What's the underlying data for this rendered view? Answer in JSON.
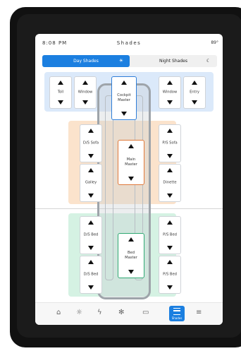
{
  "status": {
    "time": "8:08 PM",
    "title": "Shades",
    "temp": "89°"
  },
  "toggle": {
    "day_label": "Day Shades",
    "day_icon": "sun-icon",
    "night_label": "Night Shades",
    "night_icon": "moon-icon"
  },
  "controls": {
    "toll": "Toll",
    "window_left": "Window",
    "cockpit_master": "Cockpit\nMaster",
    "window_right": "Window",
    "entry": "Entry",
    "ds_sofa": "D/S Sofa",
    "ps_sofa": "P/S Sofa",
    "main_master": "Main\nMaster",
    "galley": "Galley",
    "dinette": "Dinette",
    "ds_bed_top": "D/S Bed",
    "ps_bed_top": "P/S Bed",
    "bed_master": "Bed\nMaster",
    "ds_bed_bottom": "D/S Bed",
    "ps_bed_bottom": "P/S Bed"
  },
  "nav": {
    "items": [
      "home-icon",
      "sun-icon",
      "lightning-icon",
      "fan-icon",
      "slideout-icon",
      "shades-icon",
      "menu-icon"
    ],
    "selected_label": "Shades"
  },
  "colors": {
    "accent": "#1b7fe0",
    "zone_blue": "#dbe9fa",
    "zone_orange": "#fbe3cc",
    "zone_green": "#d5f2e3"
  }
}
